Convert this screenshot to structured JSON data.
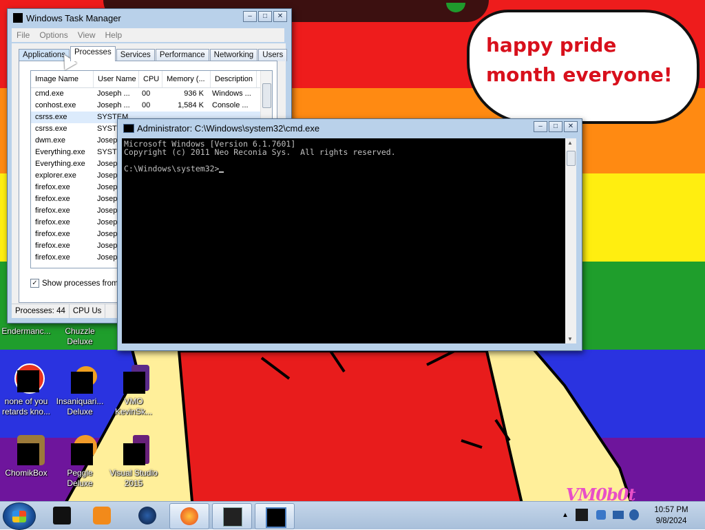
{
  "wallpaper": {
    "speech_bubble": "happy pride month everyone!",
    "signature": "VM0b0t"
  },
  "desktop_icons": [
    {
      "name": "Endermanc...",
      "x_label": "left"
    },
    {
      "name": "Chuzzle Deluxe"
    },
    {
      "name": "none of you retards kno..."
    },
    {
      "name": "Insaniquari... Deluxe"
    },
    {
      "name": "VMO KevinSk..."
    },
    {
      "name": "ChomikBox"
    },
    {
      "name": "Peggle Deluxe"
    },
    {
      "name": "Visual Studio 2015"
    }
  ],
  "task_manager": {
    "title": "Windows Task Manager",
    "menu": [
      "File",
      "Options",
      "View",
      "Help"
    ],
    "tabs": [
      "Applications",
      "Processes",
      "Services",
      "Performance",
      "Networking",
      "Users"
    ],
    "active_tab": "Processes",
    "columns": [
      "Image Name",
      "User Name",
      "CPU",
      "Memory (...",
      "Description"
    ],
    "rows": [
      {
        "image": "cmd.exe",
        "user": "Joseph ...",
        "cpu": "00",
        "mem": "936 K",
        "desc": "Windows ..."
      },
      {
        "image": "conhost.exe",
        "user": "Joseph ...",
        "cpu": "00",
        "mem": "1,584 K",
        "desc": "Console ..."
      },
      {
        "image": "csrss.exe",
        "user": "SYSTEM",
        "cpu": "",
        "mem": "",
        "desc": "",
        "selected": true
      },
      {
        "image": "csrss.exe",
        "user": "SYSTE",
        "cpu": "",
        "mem": "",
        "desc": ""
      },
      {
        "image": "dwm.exe",
        "user": "Joseph",
        "cpu": "",
        "mem": "",
        "desc": ""
      },
      {
        "image": "Everything.exe",
        "user": "SYSTE",
        "cpu": "",
        "mem": "",
        "desc": ""
      },
      {
        "image": "Everything.exe",
        "user": "Joseph",
        "cpu": "",
        "mem": "",
        "desc": ""
      },
      {
        "image": "explorer.exe",
        "user": "Joseph",
        "cpu": "",
        "mem": "",
        "desc": ""
      },
      {
        "image": "firefox.exe",
        "user": "Joseph",
        "cpu": "",
        "mem": "",
        "desc": ""
      },
      {
        "image": "firefox.exe",
        "user": "Joseph",
        "cpu": "",
        "mem": "",
        "desc": ""
      },
      {
        "image": "firefox.exe",
        "user": "Joseph",
        "cpu": "",
        "mem": "",
        "desc": ""
      },
      {
        "image": "firefox.exe",
        "user": "Joseph",
        "cpu": "",
        "mem": "",
        "desc": ""
      },
      {
        "image": "firefox.exe",
        "user": "Joseph",
        "cpu": "",
        "mem": "",
        "desc": ""
      },
      {
        "image": "firefox.exe",
        "user": "Joseph",
        "cpu": "",
        "mem": "",
        "desc": ""
      },
      {
        "image": "firefox.exe",
        "user": "Joseph",
        "cpu": "",
        "mem": "",
        "desc": ""
      }
    ],
    "show_all_label": "Show processes from a",
    "status": {
      "processes": "Processes: 44",
      "cpu": "CPU Us"
    }
  },
  "cmd": {
    "title": "Administrator: C:\\Windows\\system32\\cmd.exe",
    "line1": "Microsoft Windows [Version 6.1.7601]",
    "line2": "Copyright (c) 2011 Neo Reconia Sys.  All rights reserved.",
    "prompt": "C:\\Windows\\system32>"
  },
  "taskbar": {
    "buttons": [
      "start-orb",
      "black-app",
      "media-player",
      "globe-app",
      "firefox",
      "task-manager",
      "cmd"
    ],
    "clock_time": "10:57 PM",
    "clock_date": "9/8/2024"
  },
  "colors": {
    "red": "#ee1c1c",
    "orange": "#ff8a12",
    "yellow": "#ffee10",
    "green": "#1f9e2c",
    "blue": "#2a33e0",
    "purple": "#6e159c",
    "bubble_text": "#d8101c",
    "signature": "#e84fc7"
  }
}
